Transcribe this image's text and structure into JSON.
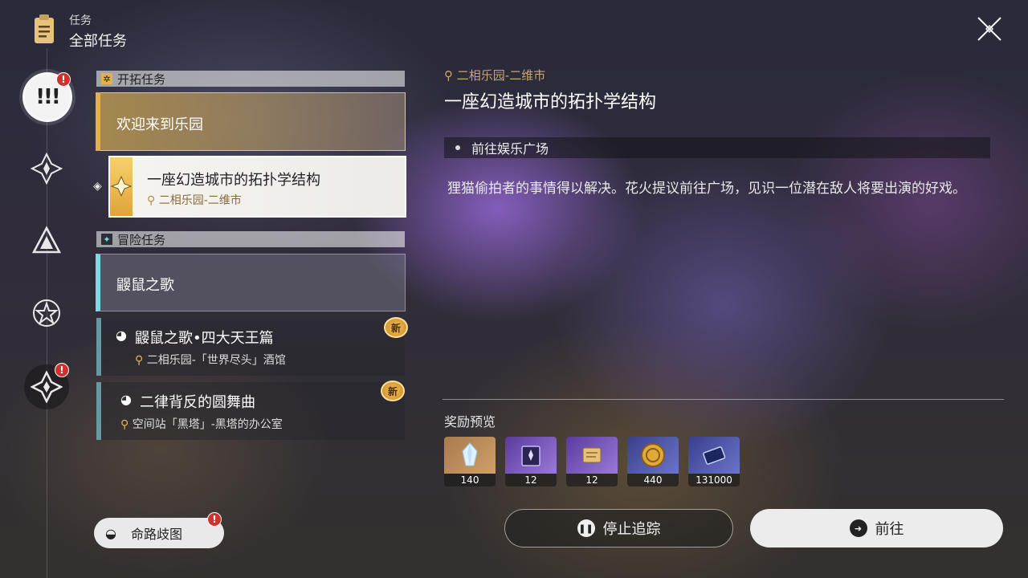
{
  "header": {
    "small_title": "任务",
    "big_title": "全部任务"
  },
  "icons": {
    "header": "clipboard-icon",
    "close": "close-icon"
  },
  "rail": {
    "active_label": "!!!",
    "badge": "!"
  },
  "sections": {
    "trailblaze": {
      "label": "开拓任务"
    },
    "adventure": {
      "label": "冒险任务"
    }
  },
  "quests": {
    "trailblaze_main": {
      "title": "欢迎来到乐园"
    },
    "trailblaze_selected": {
      "title": "一座幻造城市的拓扑学结构",
      "location": "二相乐园-二维市"
    },
    "adventure_main": {
      "title": "鼹鼠之歌"
    },
    "adventure_sub1": {
      "title": "鼹鼠之歌•四大天王篇",
      "location": "二相乐园-「世界尽头」酒馆",
      "badge": "新"
    },
    "adventure_sub2": {
      "title": "二律背反的圆舞曲",
      "location": "空间站「黑塔」-黑塔的办公室",
      "badge": "新"
    }
  },
  "path_button": {
    "label": "命路歧图",
    "badge": "!"
  },
  "detail": {
    "location": "二相乐园-二维市",
    "title": "一座幻造城市的拓扑学结构",
    "objective": "前往娱乐广场",
    "description": "狸猫偷拍者的事情得以解决。花火提议前往广场，见识一位潜在敌人将要出演的好戏。",
    "rewards_label": "奖励预览",
    "rewards": [
      {
        "name": "stellar-jade",
        "count": "140"
      },
      {
        "name": "traveler-guide",
        "count": "12"
      },
      {
        "name": "adventure-log",
        "count": "12"
      },
      {
        "name": "credit-coin",
        "count": "440"
      },
      {
        "name": "credit-card",
        "count": "131000"
      }
    ]
  },
  "buttons": {
    "stop_tracking": "停止追踪",
    "go": "前往"
  },
  "colors": {
    "gold_accent": "#e3b04a",
    "cyan_accent": "#7fd8e6",
    "alert_red": "#d0332f"
  }
}
